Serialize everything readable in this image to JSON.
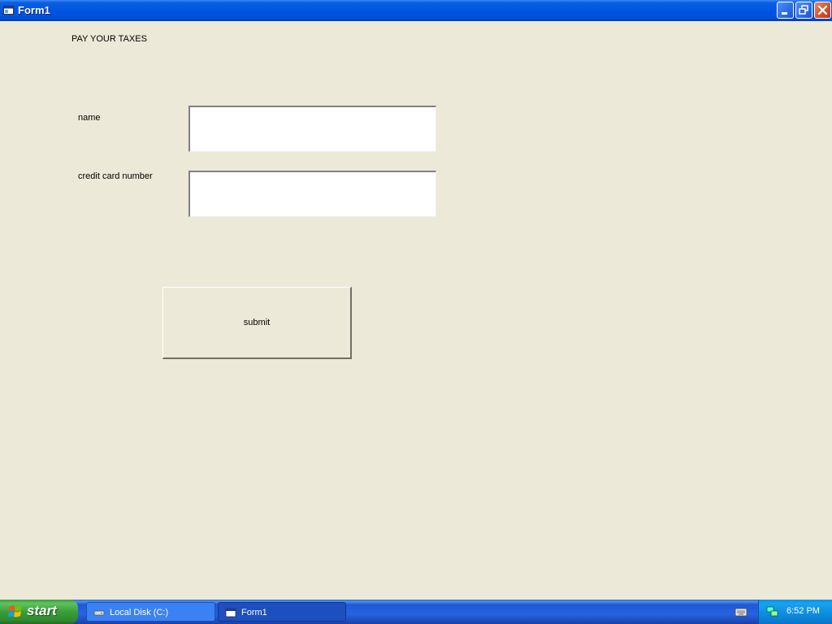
{
  "window": {
    "title": "Form1"
  },
  "form": {
    "heading": "PAY YOUR TAXES",
    "name_label": "name",
    "name_value": "",
    "card_label": "credit card number",
    "card_value": "",
    "submit_label": "submit"
  },
  "taskbar": {
    "start_label": "start",
    "tasks": [
      {
        "label": "Local Disk (C:)",
        "icon": "drive-icon",
        "active": false
      },
      {
        "label": "Form1",
        "icon": "form-icon",
        "active": true
      }
    ],
    "clock": "6:52 PM"
  },
  "colors": {
    "form_background": "#ece9d8",
    "titlebar_blue": "#0054e3",
    "taskbar_blue": "#2663e0",
    "start_green": "#3a9e3a"
  }
}
